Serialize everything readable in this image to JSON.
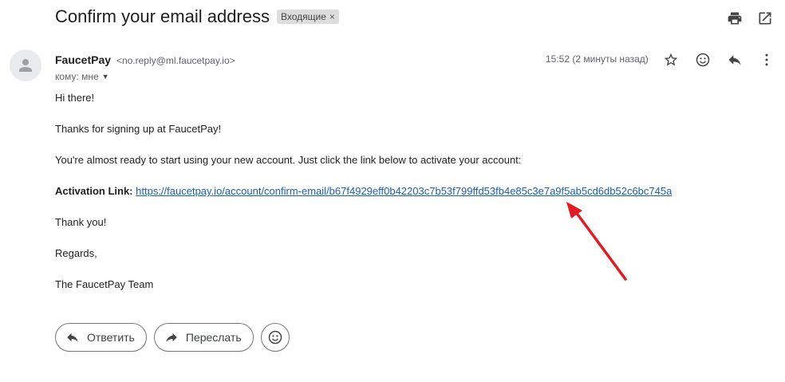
{
  "subject": {
    "title": "Confirm your email address",
    "label_chip": "Входящие",
    "label_remove": "×"
  },
  "toolbar": {
    "icons": [
      "print-icon",
      "open-in-new-window-icon"
    ]
  },
  "sender": {
    "name": "FaucetPay",
    "email": "<no.reply@ml.faucetpay.io>",
    "to_text": "кому: мне",
    "time": "15:52 (2 минуты назад)"
  },
  "message_actions": {
    "icons": [
      "star-icon",
      "emoji-react-icon",
      "reply-icon",
      "more-vert-icon"
    ]
  },
  "body": {
    "greeting": "Hi there!",
    "thanks": "Thanks for signing up at FaucetPay!",
    "instruction": "You're almost ready to start using your new account. Just click the link below to activate your account:",
    "activation_label": "Activation Link:",
    "activation_url": "https://faucetpay.io/account/confirm-email/b67f4929eff0b42203c7b53f799ffd53fb4e85c3e7a9f5ab5cd6db52c6bc745a",
    "thank_you": "Thank you!",
    "regards": "Regards,",
    "signature": "The FaucetPay Team"
  },
  "footer_actions": {
    "reply_label": "Ответить",
    "forward_label": "Переслать"
  },
  "annotation": {
    "arrow_color": "#e01b24"
  }
}
